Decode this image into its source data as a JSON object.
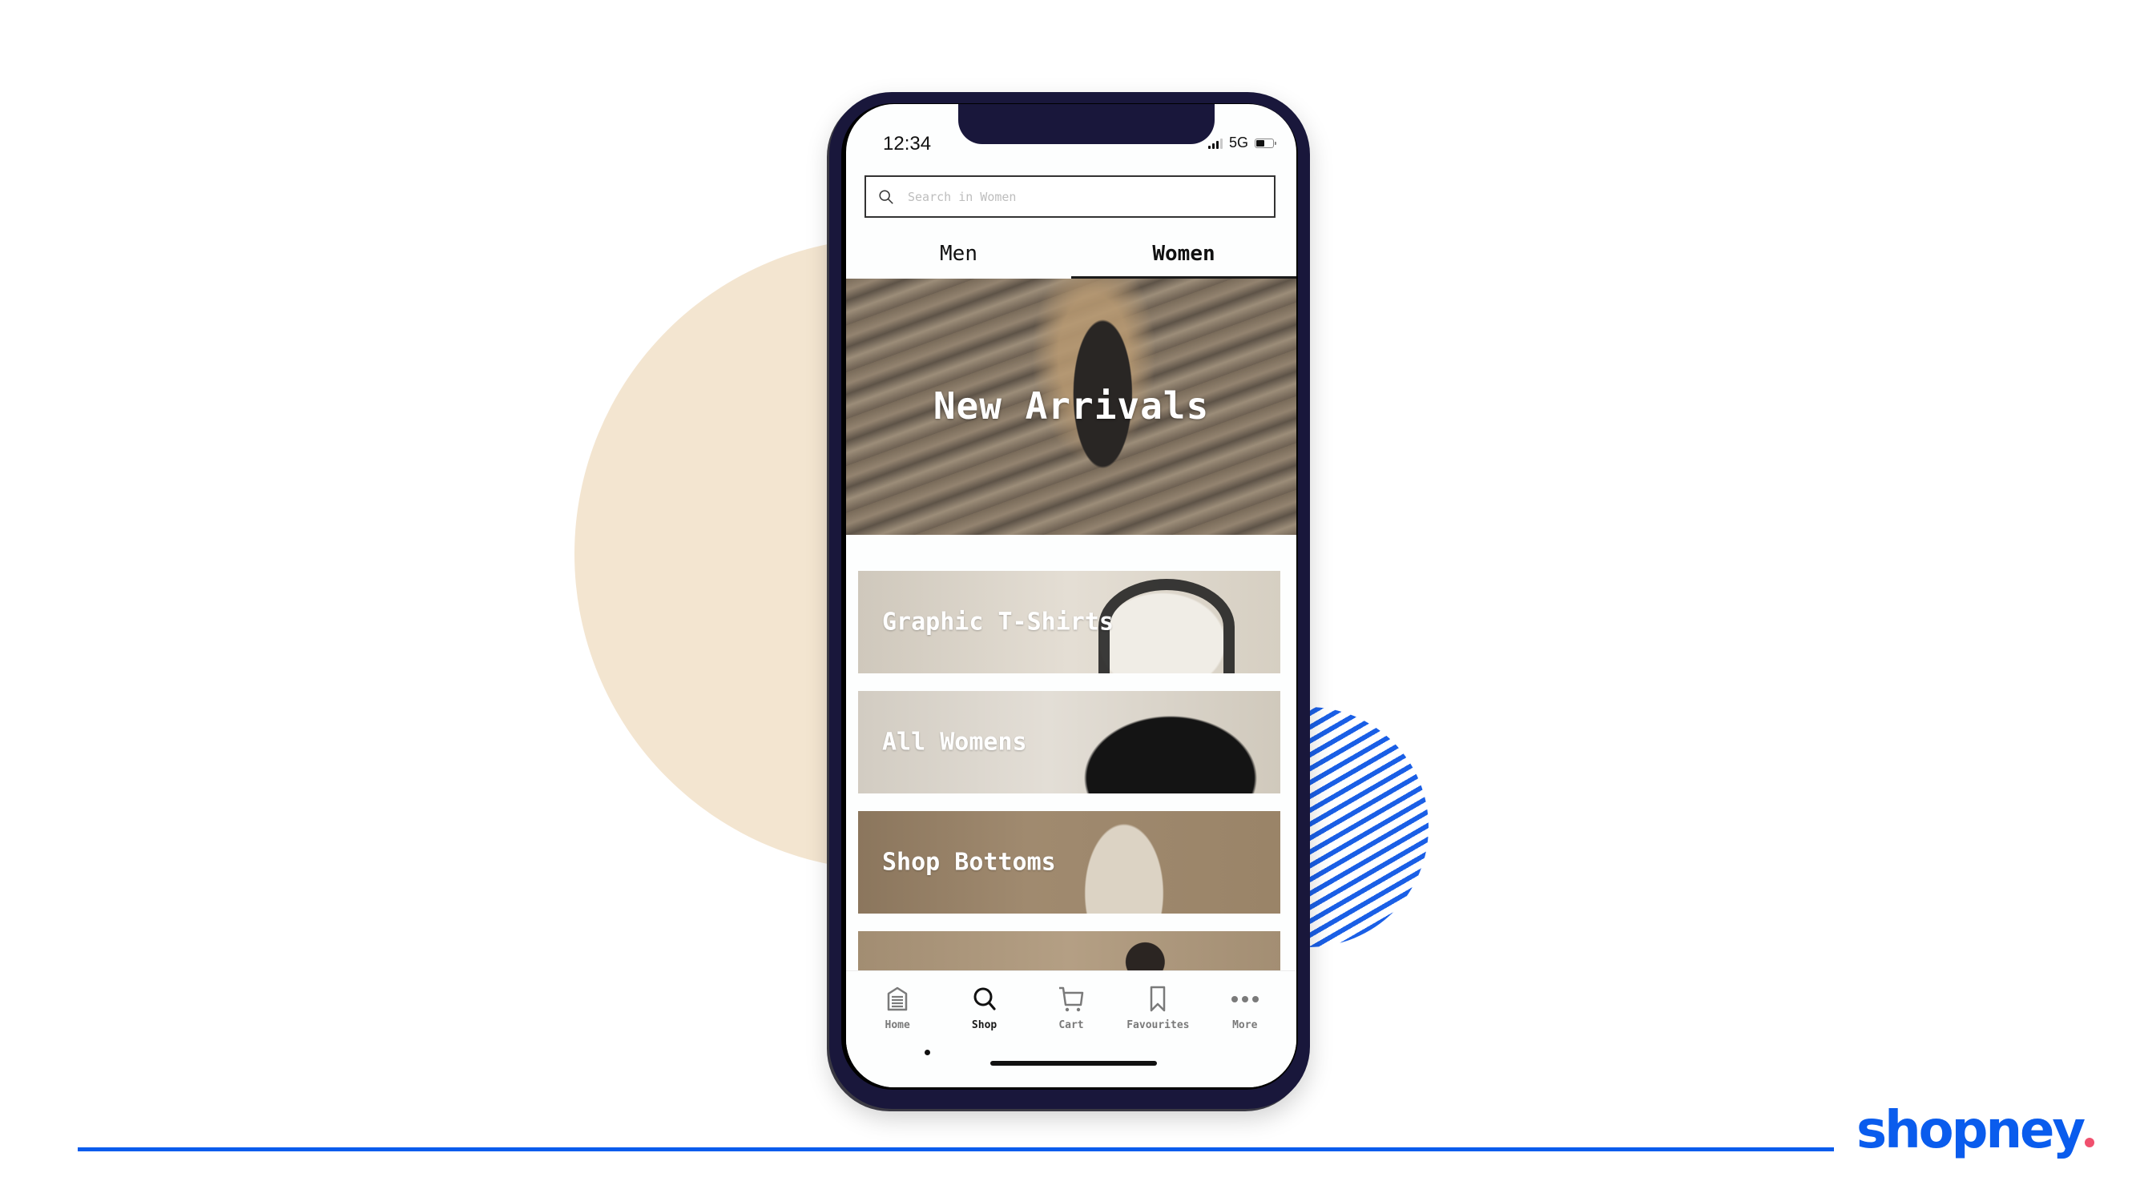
{
  "brand": {
    "logo_text": "shopney",
    "primary_color": "#0a5ced",
    "accent_dot_color": "#f0506e",
    "beige_color": "#f3e5d0",
    "phone_frame_color": "#19173b"
  },
  "status_bar": {
    "time": "12:34",
    "network": "5G",
    "signal_bars_filled": 3,
    "signal_bars_total": 4,
    "battery_level": 0.5
  },
  "search": {
    "placeholder": "Search in Women",
    "value": "",
    "icon": "search-icon"
  },
  "gender_tabs": [
    {
      "label": "Men",
      "active": false
    },
    {
      "label": "Women",
      "active": true
    }
  ],
  "hero": {
    "title": "New Arrivals"
  },
  "categories": [
    {
      "label": "Graphic T-Shirts"
    },
    {
      "label": "All Womens"
    },
    {
      "label": "Shop Bottoms"
    },
    {
      "label": ""
    }
  ],
  "tab_bar": {
    "active_index": 1,
    "items": [
      {
        "label": "Home",
        "icon": "home-icon"
      },
      {
        "label": "Shop",
        "icon": "search-icon"
      },
      {
        "label": "Cart",
        "icon": "cart-icon"
      },
      {
        "label": "Favourites",
        "icon": "bookmark-icon"
      },
      {
        "label": "More",
        "icon": "more-dots-icon"
      }
    ]
  }
}
